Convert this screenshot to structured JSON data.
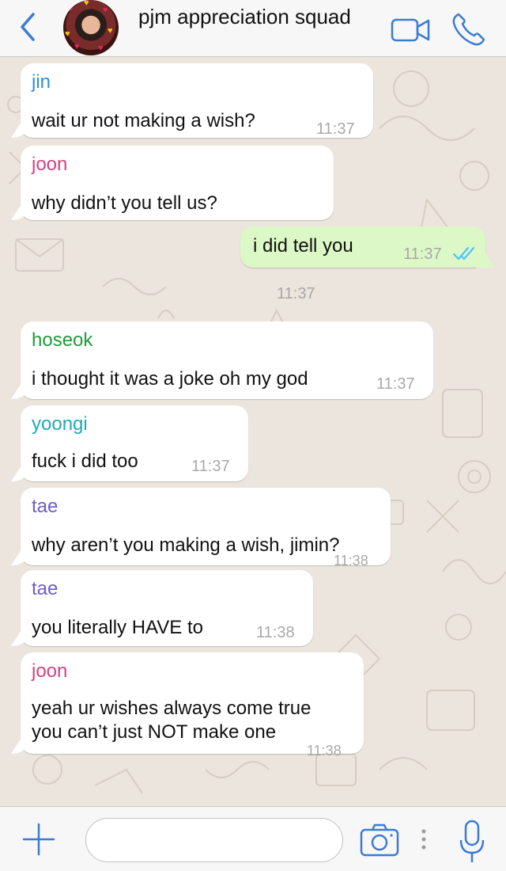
{
  "header": {
    "title": "pjm appreciation squad",
    "back_icon": "chevron-left-icon",
    "video_icon": "video-camera-icon",
    "call_icon": "phone-icon"
  },
  "colors": {
    "accent": "#3a7bd5",
    "chat_bg": "#ece5dd",
    "incoming_bubble": "#ffffff",
    "outgoing_bubble": "#dcf8c6",
    "timestamp": "#a8a8a8",
    "read_ticks": "#4fc3f7"
  },
  "messages": [
    {
      "sender": "jin",
      "sender_color": "#2f8fd8",
      "text": "wait ur not making a wish?",
      "time": "11:37"
    },
    {
      "sender": "joon",
      "sender_color": "#d6417f",
      "text": "why didn’t you tell us?",
      "time": "11:37"
    },
    {
      "text": "i did tell you",
      "time": "11:37",
      "status": "read"
    },
    {
      "sender": "hoseok",
      "sender_color": "#1f9b3a",
      "text": "i thought it was a joke oh my god",
      "time": "11:37"
    },
    {
      "sender": "yoongi",
      "sender_color": "#1eaab8",
      "text": "fuck i did too",
      "time": "11:37"
    },
    {
      "sender": "tae",
      "sender_color": "#6f5bc9",
      "text": "why aren’t you making a wish, jimin?",
      "time": "11:38"
    },
    {
      "sender": "tae",
      "sender_color": "#6f5bc9",
      "text": "you literally HAVE to",
      "time": "11:38"
    },
    {
      "sender": "joon",
      "sender_color": "#d6417f",
      "text_line1": "yeah ur wishes always come true",
      "text_line2": "you can’t just NOT make one",
      "time": "11:38"
    }
  ],
  "composer": {
    "placeholder": "",
    "value": "",
    "plus_icon": "plus-icon",
    "camera_icon": "camera-icon",
    "mic_icon": "microphone-icon"
  }
}
